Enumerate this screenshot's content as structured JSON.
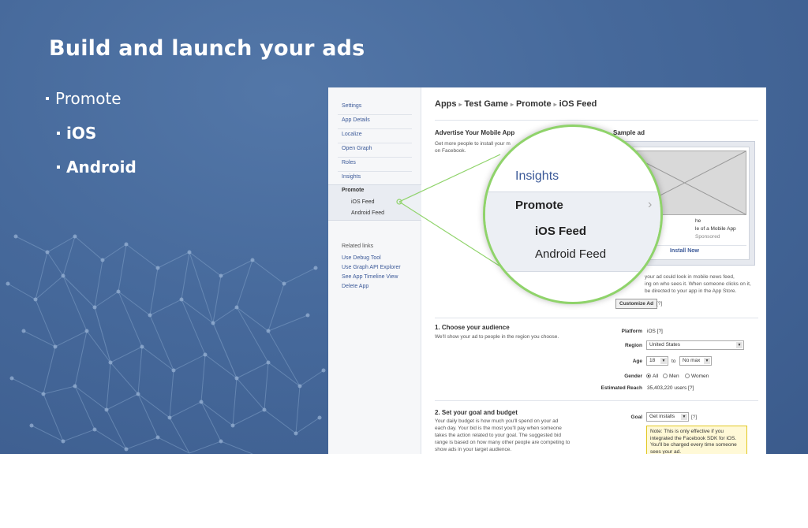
{
  "slide": {
    "title": "Build and launch your ads",
    "bullets": {
      "promote": "Promote",
      "ios": "iOS",
      "android": "Android"
    },
    "colors": {
      "background": "#46699b",
      "lens_ring": "#8fd36a",
      "link": "#3b5998"
    }
  },
  "screenshot": {
    "nav": {
      "items": [
        "Settings",
        "App Details",
        "Localize",
        "Open Graph",
        "Roles",
        "Insights"
      ],
      "promote": "Promote",
      "sub_items": [
        "iOS Feed",
        "Android Feed"
      ],
      "related_title": "Related links",
      "related_links": [
        "Use Debug Tool",
        "Use Graph API Explorer",
        "See App Timeline View",
        "Delete App"
      ]
    },
    "breadcrumb": [
      "Apps",
      "Test Game",
      "Promote",
      "iOS Feed"
    ],
    "advertise": {
      "title": "Advertise Your Mobile App",
      "desc_1": "Get more people to install your m",
      "desc_2": "on Facebook."
    },
    "sample_ad": {
      "title": "Sample ad",
      "name_fragment": "he",
      "line_2": "le of a Mobile App",
      "line_3": "Sponsored",
      "install": "Install Now",
      "caption_1": "your ad could look in mobile news feed,",
      "caption_2": "ing on who sees it. When someone clicks on it,",
      "caption_3": "be directed to your app in the App Store.",
      "customize_label": "Customize Ad",
      "help": "[?]"
    },
    "audience": {
      "title": "1. Choose your audience",
      "desc": "We'll show your ad to people in the region you choose.",
      "platform_label": "Platform",
      "platform_value": "iOS [?]",
      "region_label": "Region",
      "region_value": "United States",
      "age_label": "Age",
      "age_min": "18",
      "age_to": "to",
      "age_max": "No max",
      "gender_label": "Gender",
      "gender_options": [
        "All",
        "Men",
        "Women"
      ],
      "reach_label": "Estimated Reach",
      "reach_value": "35,403,220 users [?]"
    },
    "budget": {
      "title": "2. Set your goal and budget",
      "desc_lines": [
        "Your daily budget is how much you'll spend on your ad",
        "each day. Your bid is the most you'll pay when someone",
        "takes the action related to your goal. The suggested bid",
        "range is based on how many other people are competing to",
        "show ads in your target audience."
      ],
      "goal_label": "Goal",
      "goal_value": "Get installs",
      "help": "[?]",
      "note": "Note: This is only effective if you integrated the Facebook SDK for iOS. You'll be charged every time someone sees your ad."
    },
    "lens": {
      "insights": "Insights",
      "promote": "Promote",
      "chevron": "›",
      "ios": "iOS Feed",
      "android": "Android Feed"
    }
  }
}
